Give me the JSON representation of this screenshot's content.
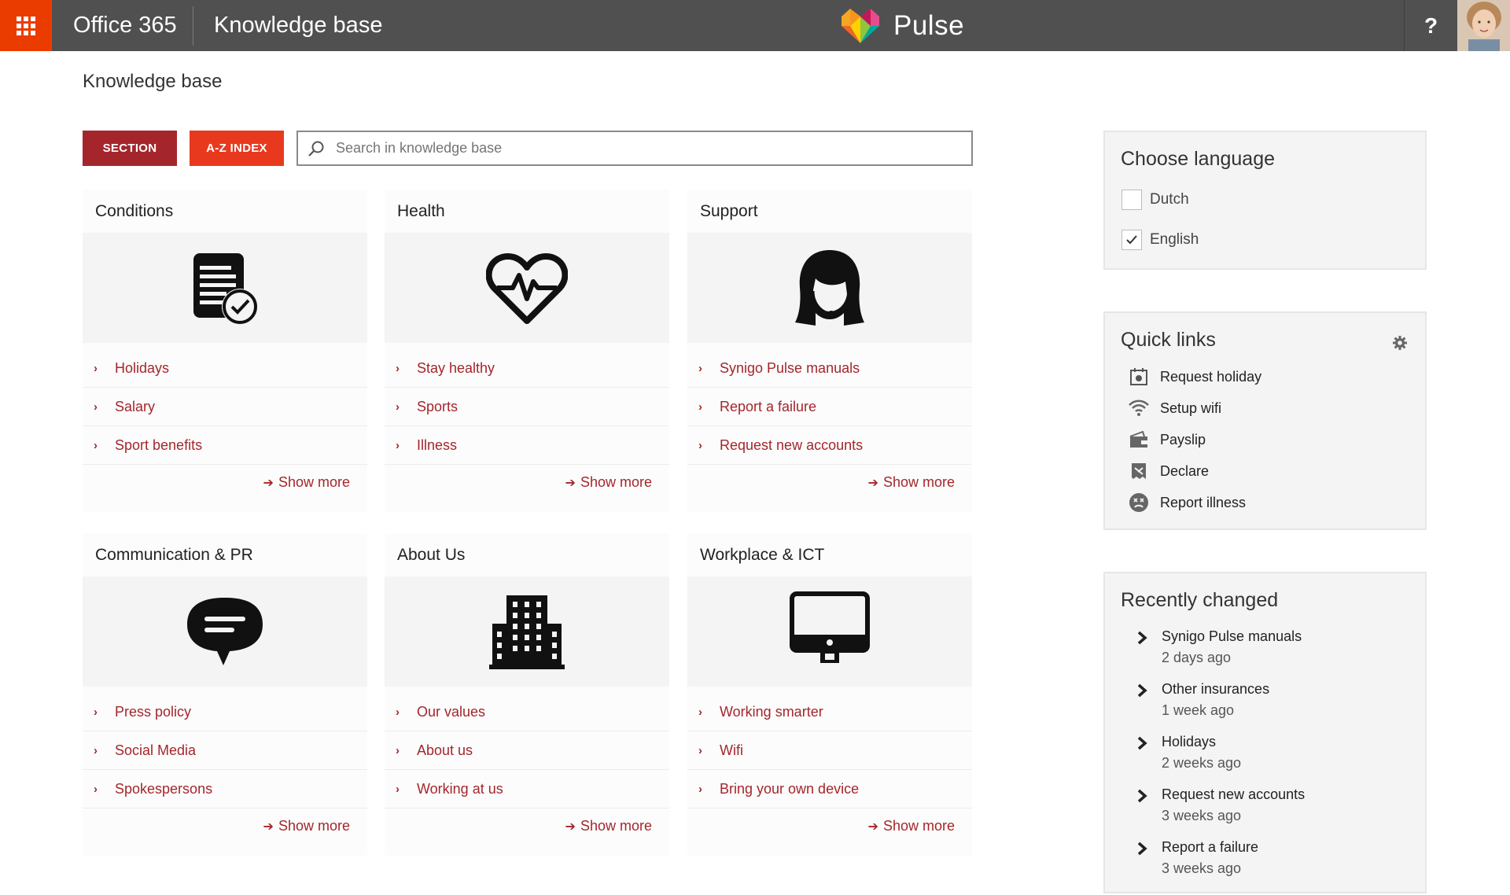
{
  "header": {
    "app_title": "Office 365",
    "site_title": "Knowledge base",
    "brand_name": "Pulse",
    "help_label": "?"
  },
  "page": {
    "title": "Knowledge base"
  },
  "toolbar": {
    "section_label": "SECTION",
    "az_label": "A-Z INDEX",
    "search_placeholder": "Search in knowledge base"
  },
  "cards": [
    {
      "title": "Conditions",
      "icon": "document-check-icon",
      "links": [
        "Holidays",
        "Salary",
        "Sport benefits"
      ],
      "show_more": "Show more"
    },
    {
      "title": "Health",
      "icon": "heartbeat-icon",
      "links": [
        "Stay healthy",
        "Sports",
        "Illness"
      ],
      "show_more": "Show more"
    },
    {
      "title": "Support",
      "icon": "support-person-icon",
      "links": [
        "Synigo Pulse manuals",
        "Report a failure",
        "Request new accounts"
      ],
      "show_more": "Show more"
    },
    {
      "title": "Communication & PR",
      "icon": "speech-bubble-icon",
      "links": [
        "Press policy",
        "Social Media",
        "Spokespersons"
      ],
      "show_more": "Show more"
    },
    {
      "title": "About Us",
      "icon": "building-icon",
      "links": [
        "Our values",
        "About us",
        "Working at us"
      ],
      "show_more": "Show more"
    },
    {
      "title": "Workplace & ICT",
      "icon": "monitor-icon",
      "links": [
        "Working smarter",
        "Wifi",
        "Bring your own device"
      ],
      "show_more": "Show more"
    }
  ],
  "language": {
    "title": "Choose language",
    "options": [
      {
        "label": "Dutch",
        "checked": false
      },
      {
        "label": "English",
        "checked": true
      }
    ]
  },
  "quick_links": {
    "title": "Quick links",
    "items": [
      {
        "label": "Request holiday",
        "icon": "calendar-icon"
      },
      {
        "label": "Setup wifi",
        "icon": "wifi-icon"
      },
      {
        "label": "Payslip",
        "icon": "wallet-icon"
      },
      {
        "label": "Declare",
        "icon": "receipt-icon"
      },
      {
        "label": "Report illness",
        "icon": "sick-face-icon"
      }
    ]
  },
  "recently_changed": {
    "title": "Recently changed",
    "items": [
      {
        "title": "Synigo Pulse manuals",
        "time": "2 days ago"
      },
      {
        "title": "Other insurances",
        "time": "1 week ago"
      },
      {
        "title": "Holidays",
        "time": "2 weeks ago"
      },
      {
        "title": "Request new accounts",
        "time": "3 weeks ago"
      },
      {
        "title": "Report a failure",
        "time": "3 weeks ago"
      }
    ]
  },
  "colors": {
    "topbar": "#505050",
    "waffle": "#eb3c00",
    "accent_dark_red": "#a4262c",
    "accent_red": "#e8391f"
  }
}
